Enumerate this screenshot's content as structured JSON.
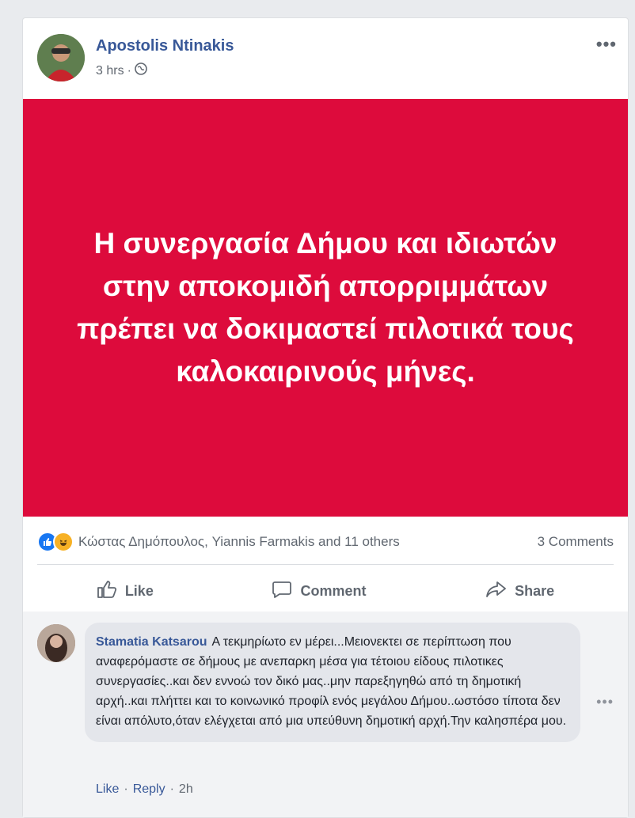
{
  "post": {
    "author": "Apostolis Ntinakis",
    "time": "3 hrs",
    "separator": "·",
    "privacy_icon": "globe-icon",
    "more_label": "•••",
    "banner_text": "Η συνεργασία Δήμου και ιδιωτών στην αποκομιδή απορριμμάτων πρέπει να δοκιμαστεί πιλοτικά τους καλοκαιρινούς μήνες.",
    "banner_color": "#dd0b3c"
  },
  "reactions": {
    "icons": [
      "like-icon",
      "haha-icon"
    ],
    "summary": "Κώστας Δημόπουλος, Yiannis Farmakis and 11 others",
    "comments_count": "3 Comments"
  },
  "actions": {
    "like": "Like",
    "comment": "Comment",
    "share": "Share"
  },
  "comment": {
    "author": "Stamatia Katsarou",
    "text": "Α τεκμηρίωτο εν μέρει...Μειονεκτει σε περίπτωση που αναφερόμαστε σε δήμους με ανεπαρκη μέσα για τέτοιου είδους πιλοτικες συνεργασίες..και δεν εννοώ τον δικό μας..μην παρεξηγηθώ από τη δημοτική αρχή..και πλήττει και το κοινωνικό προφίλ ενός μεγάλου Δήμου..ωστόσο τίποτα δεν είναι απόλυτο,όταν ελέγχεται από μια υπεύθυνη δημοτική αρχή.Την καλησπέρα μου.",
    "like_label": "Like",
    "reply_label": "Reply",
    "time": "2h",
    "separator": "·",
    "more_label": "•••"
  }
}
